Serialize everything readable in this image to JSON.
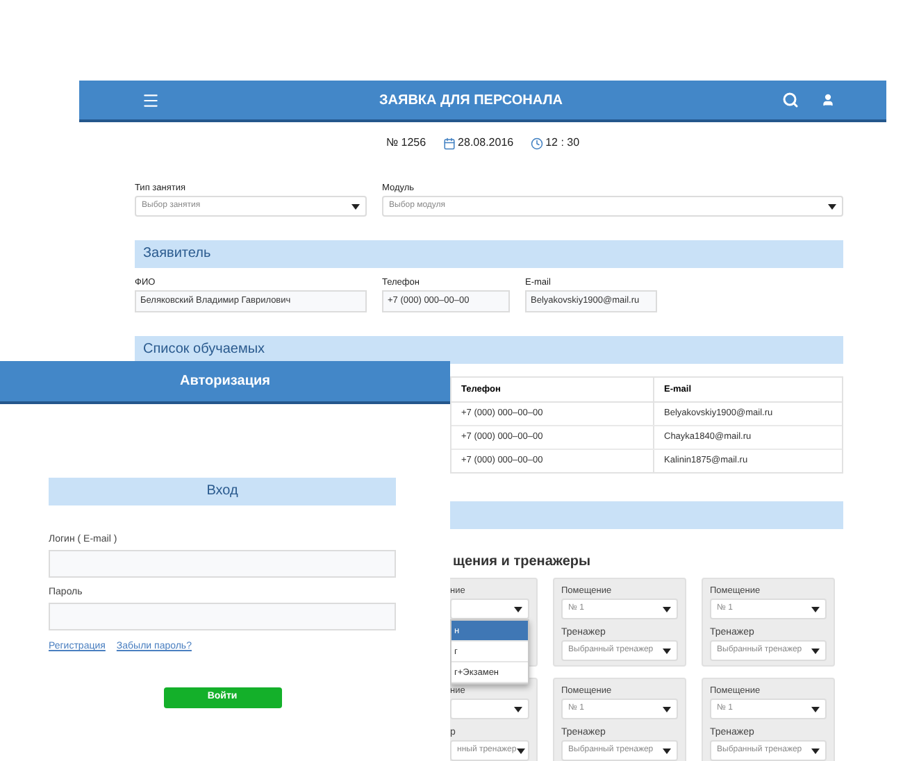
{
  "request_window": {
    "title": "ЗАЯВКА ДЛЯ ПЕРСОНАЛА",
    "number": "№ 1256",
    "date": "28.08.2016",
    "time": "12 : 30",
    "fields": [
      {
        "label": "Тип занятия",
        "placeholder": "Выбор занятия"
      },
      {
        "label": "Модуль",
        "placeholder": "Выбор модуля"
      }
    ],
    "applicant": {
      "title": "Заявитель",
      "fields": [
        {
          "label": "ФИО",
          "value": "Беляковский Владимир Гаврилович"
        },
        {
          "label": "Телефон",
          "value": "+7 (000) 000–00–00"
        },
        {
          "label": "E-mail",
          "value": "Belyakovskiy1900@mail.ru"
        }
      ]
    },
    "trainees": {
      "title": "Список обучаемых",
      "columns": [
        "Телефон",
        "E-mail"
      ],
      "rows": [
        [
          "+7 (000) 000–00–00",
          "Belyakovskiy1900@mail.ru"
        ],
        [
          "+7 (000) 000–00–00",
          "Chayka1840@mail.ru"
        ],
        [
          "+7 (000) 000–00–00",
          "Kalinin1875@mail.ru"
        ]
      ]
    },
    "rooms": {
      "title": "щения и тренажеры",
      "cards": [
        {
          "room_label": "ние",
          "options": [
            {
              "label": "н",
              "selected": true
            },
            {
              "label": "г",
              "selected": false
            },
            {
              "label": "г+Экзамен",
              "selected": false
            }
          ]
        },
        {
          "room_label": "Помещение",
          "room_value": "№ 1",
          "trainer_label": "Тренажер",
          "trainer_value": "Выбранный тренажер"
        },
        {
          "room_label": "Помещение",
          "room_value": "№ 1",
          "trainer_label": "Тренажер",
          "trainer_value": "Выбранный тренажер"
        },
        {
          "room_label": "ние",
          "trainer_label": "р",
          "trainer_value": "нный тренажер"
        },
        {
          "room_label": "Помещение",
          "room_value": "№ 1",
          "trainer_label": "Тренажер",
          "trainer_value": "Выбранный тренажер"
        },
        {
          "room_label": "Помещение",
          "room_value": "№ 1",
          "trainer_label": "Тренажер",
          "trainer_value": "Выбранный тренажер"
        }
      ]
    }
  },
  "login_window": {
    "title": "Авторизация",
    "heading": "Вход",
    "fields": [
      {
        "label": "Логин ( E-mail )"
      },
      {
        "label": "Пароль"
      }
    ],
    "links": [
      "Регистрация",
      "Забыли пароль?"
    ],
    "button": "Войти"
  }
}
